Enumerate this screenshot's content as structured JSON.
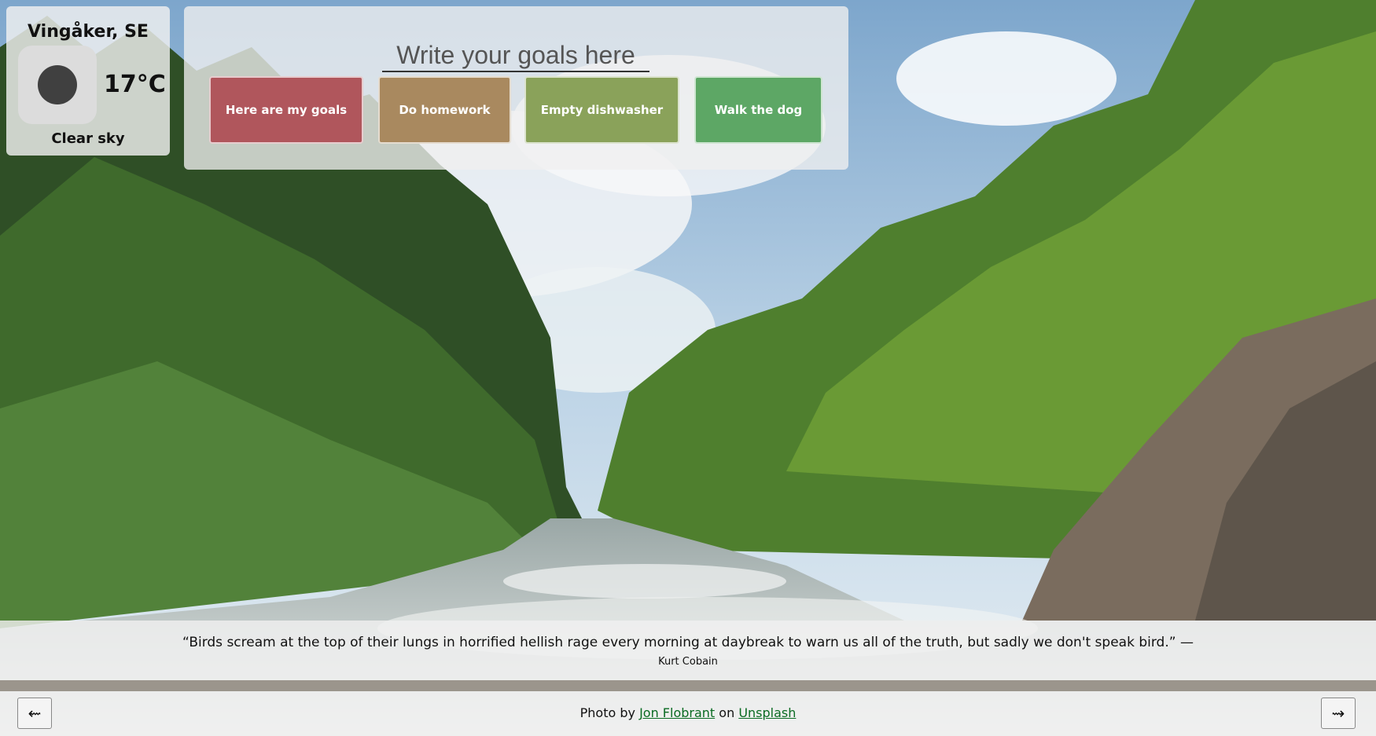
{
  "weather": {
    "location": "Vingåker, SE",
    "temperature": "17°C",
    "condition": "Clear sky",
    "icon": "clear-sky-icon"
  },
  "goals": {
    "placeholder": "Write your goals here",
    "items": [
      {
        "label": "Here are my goals",
        "color": "#b0565c"
      },
      {
        "label": "Do homework",
        "color": "#a9895f"
      },
      {
        "label": "Empty dishwasher",
        "color": "#8aa25a"
      },
      {
        "label": "Walk the dog",
        "color": "#5da765"
      }
    ]
  },
  "quote": {
    "text": "“Birds scream at the top of their lungs in horrified hellish rage every morning at daybreak to warn us all of the truth, but sadly we don't speak bird.” —",
    "author": "Kurt Cobain"
  },
  "credit": {
    "prefix": "Photo by",
    "photographer": "Jon Flobrant",
    "middle": "on",
    "site": "Unsplash"
  },
  "nav": {
    "prev_icon": "arrow-left-icon",
    "next_icon": "arrow-right-icon",
    "prev_glyph": "⇜",
    "next_glyph": "⇝"
  }
}
